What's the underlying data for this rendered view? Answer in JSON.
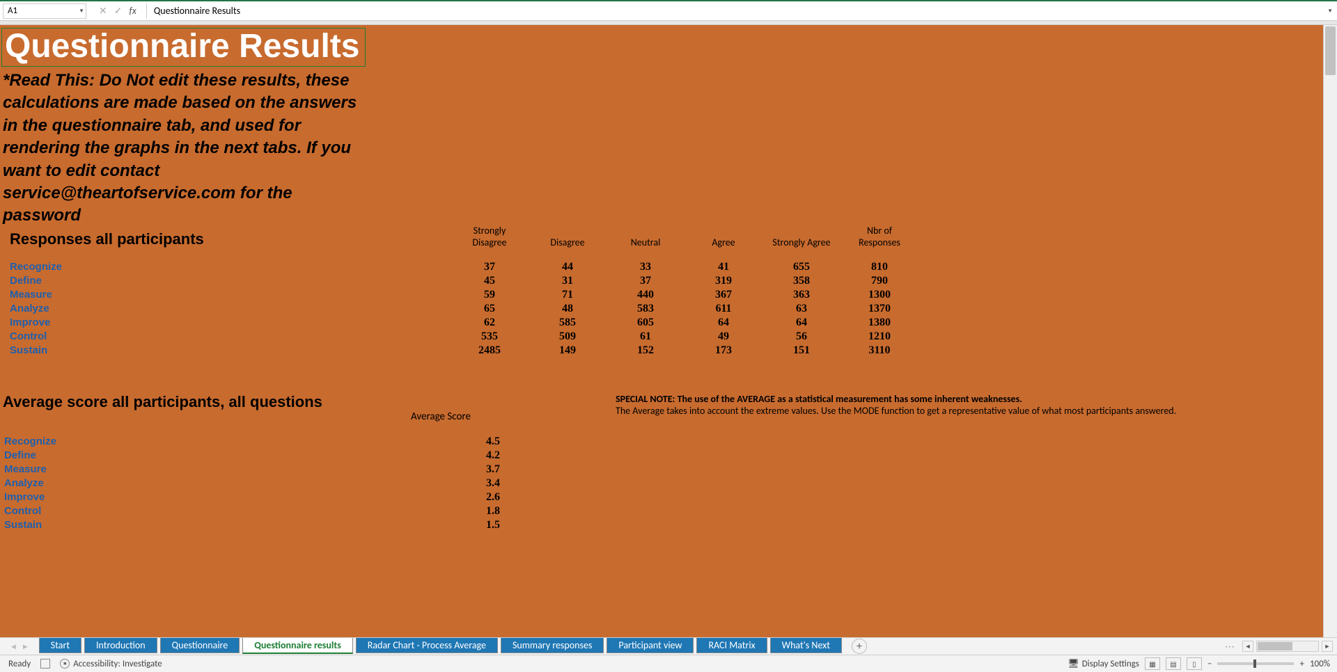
{
  "cell_ref": "A1",
  "formula_value": "Questionnaire Results",
  "title": "Questionnaire Results",
  "read_this": "*Read This: Do Not edit these results, these calculations are made based on the answers in the questionnaire tab, and used for rendering the graphs in the next tabs. If you want to edit contact service@theartofservice.com for the password",
  "section1_head": "Responses all participants",
  "columns": {
    "c1": "Strongly Disagree",
    "c2": "Disagree",
    "c3": "Neutral",
    "c4": "Agree",
    "c5": "Strongly Agree",
    "c6": "Nbr of Responses"
  },
  "rows": [
    {
      "cat": "Recognize",
      "v": [
        "37",
        "44",
        "33",
        "41",
        "655",
        "810"
      ]
    },
    {
      "cat": "Define",
      "v": [
        "45",
        "31",
        "37",
        "319",
        "358",
        "790"
      ]
    },
    {
      "cat": "Measure",
      "v": [
        "59",
        "71",
        "440",
        "367",
        "363",
        "1300"
      ]
    },
    {
      "cat": "Analyze",
      "v": [
        "65",
        "48",
        "583",
        "611",
        "63",
        "1370"
      ]
    },
    {
      "cat": "Improve",
      "v": [
        "62",
        "585",
        "605",
        "64",
        "64",
        "1380"
      ]
    },
    {
      "cat": "Control",
      "v": [
        "535",
        "509",
        "61",
        "49",
        "56",
        "1210"
      ]
    },
    {
      "cat": "Sustain",
      "v": [
        "2485",
        "149",
        "152",
        "173",
        "151",
        "3110"
      ]
    }
  ],
  "section2_head": "Average score all participants, all questions",
  "avg_col_label": "Average Score",
  "avg_note_bold": "SPECIAL NOTE: The use of the AVERAGE as a statistical measurement has some inherent weaknesses.",
  "avg_note_text": "The Average takes into account the extreme values. Use the MODE function to get a representative value of what most participants answered.",
  "avg_rows": [
    {
      "cat": "Recognize",
      "v": "4.5"
    },
    {
      "cat": "Define",
      "v": "4.2"
    },
    {
      "cat": "Measure",
      "v": "3.7"
    },
    {
      "cat": "Analyze",
      "v": "3.4"
    },
    {
      "cat": "Improve",
      "v": "2.6"
    },
    {
      "cat": "Control",
      "v": "1.8"
    },
    {
      "cat": "Sustain",
      "v": "1.5"
    }
  ],
  "tabs": [
    {
      "label": "Start",
      "active": false
    },
    {
      "label": "Introduction",
      "active": false
    },
    {
      "label": "Questionnaire",
      "active": false
    },
    {
      "label": "Questionnaire results",
      "active": true
    },
    {
      "label": "Radar Chart - Process Average",
      "active": false
    },
    {
      "label": "Summary responses",
      "active": false
    },
    {
      "label": "Participant view",
      "active": false
    },
    {
      "label": "RACI Matrix",
      "active": false
    },
    {
      "label": "What's Next",
      "active": false
    }
  ],
  "status": {
    "ready": "Ready",
    "accessibility": "Accessibility: Investigate",
    "display_settings": "Display Settings",
    "zoom": "100%"
  },
  "chart_data": {
    "type": "table",
    "title": "Responses all participants",
    "columns": [
      "Strongly Disagree",
      "Disagree",
      "Neutral",
      "Agree",
      "Strongly Agree",
      "Nbr of Responses"
    ],
    "categories": [
      "Recognize",
      "Define",
      "Measure",
      "Analyze",
      "Improve",
      "Control",
      "Sustain"
    ],
    "series": [
      {
        "name": "Strongly Disagree",
        "values": [
          37,
          45,
          59,
          65,
          62,
          535,
          2485
        ]
      },
      {
        "name": "Disagree",
        "values": [
          44,
          31,
          71,
          48,
          585,
          509,
          149
        ]
      },
      {
        "name": "Neutral",
        "values": [
          33,
          37,
          440,
          583,
          605,
          61,
          152
        ]
      },
      {
        "name": "Agree",
        "values": [
          41,
          319,
          367,
          611,
          64,
          49,
          173
        ]
      },
      {
        "name": "Strongly Agree",
        "values": [
          655,
          358,
          363,
          63,
          64,
          56,
          151
        ]
      },
      {
        "name": "Nbr of Responses",
        "values": [
          810,
          790,
          1300,
          1370,
          1380,
          1210,
          3110
        ]
      }
    ],
    "averages": {
      "Recognize": 4.5,
      "Define": 4.2,
      "Measure": 3.7,
      "Analyze": 3.4,
      "Improve": 2.6,
      "Control": 1.8,
      "Sustain": 1.5
    }
  }
}
